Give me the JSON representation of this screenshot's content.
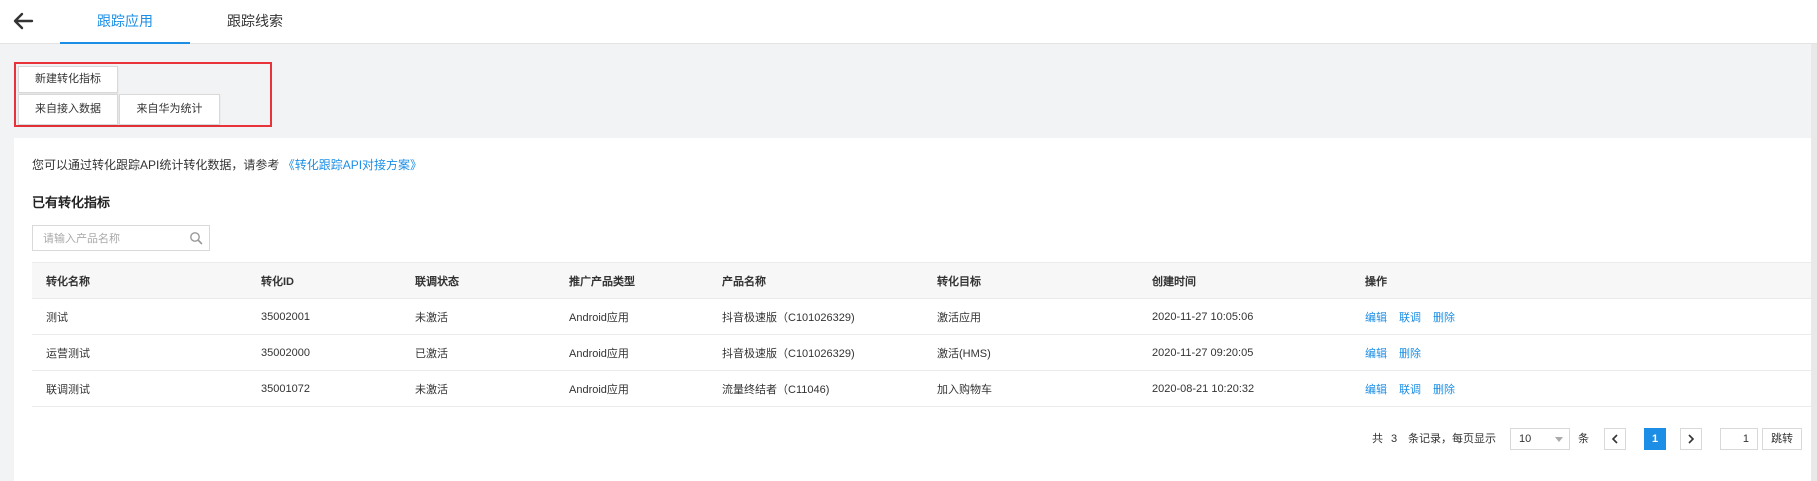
{
  "tabs": [
    {
      "label": "跟踪应用",
      "active": true
    },
    {
      "label": "跟踪线索",
      "active": false
    }
  ],
  "dropdown": {
    "new_label": "新建转化指标",
    "from_access": "来自接入数据",
    "from_huawei": "来自华为统计"
  },
  "info": {
    "text": "您可以通过转化跟踪API统计转化数据，请参考",
    "link": "《转化跟踪API对接方案》"
  },
  "section_title": "已有转化指标",
  "search": {
    "placeholder": "请输入产品名称",
    "value": ""
  },
  "table": {
    "headers": [
      "转化名称",
      "转化ID",
      "联调状态",
      "推广产品类型",
      "产品名称",
      "转化目标",
      "创建时间",
      "操作"
    ],
    "rows": [
      {
        "name": "测试",
        "id": "35002001",
        "status": "未激活",
        "type": "Android应用",
        "product": "抖音极速版（C101026329)",
        "target": "激活应用",
        "time": "2020-11-27 10:05:06",
        "ops": [
          "编辑",
          "联调",
          "删除"
        ]
      },
      {
        "name": "运营测试",
        "id": "35002000",
        "status": "已激活",
        "type": "Android应用",
        "product": "抖音极速版（C101026329)",
        "target": "激活(HMS)",
        "time": "2020-11-27 09:20:05",
        "ops": [
          "编辑",
          "删除"
        ]
      },
      {
        "name": "联调测试",
        "id": "35001072",
        "status": "未激活",
        "type": "Android应用",
        "product": "流量终结者（C11046)",
        "target": "加入购物车",
        "time": "2020-08-21 10:20:32",
        "ops": [
          "编辑",
          "联调",
          "删除"
        ]
      }
    ]
  },
  "pagination": {
    "total_prefix": "共",
    "total": "3",
    "total_suffix": "条记录，每页显示",
    "page_size": "10",
    "unit": "条",
    "prev": "<",
    "current": "1",
    "next": ">",
    "jump_value": "1",
    "jump_label": "跳转"
  },
  "colors": {
    "accent": "#1c8ee6",
    "highlight_border": "#e8333a"
  }
}
